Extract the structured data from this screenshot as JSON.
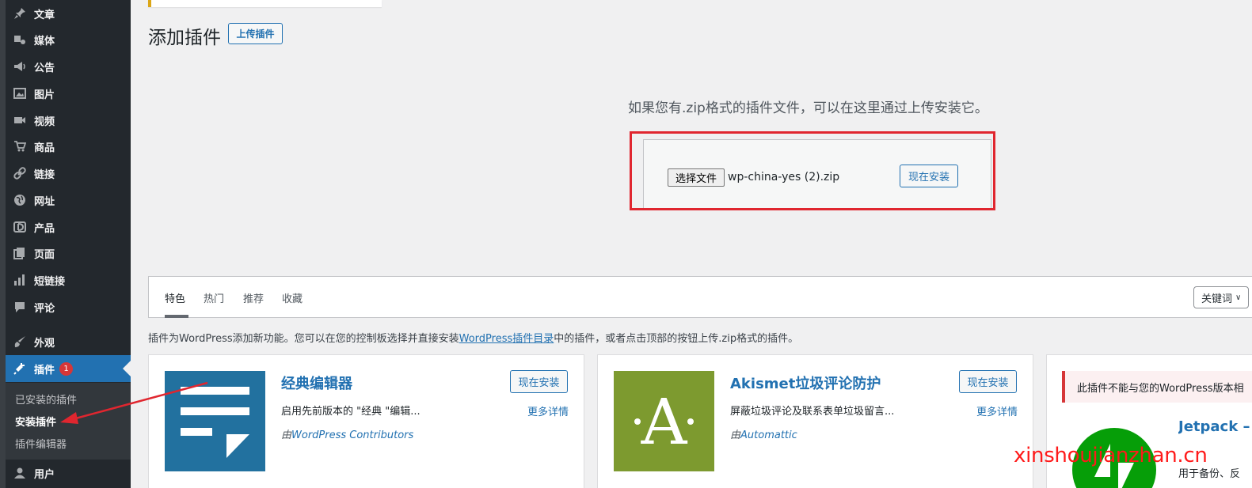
{
  "sidebar": {
    "items": [
      {
        "label": "文章",
        "icon": "pin-icon"
      },
      {
        "label": "媒体",
        "icon": "media-icon"
      },
      {
        "label": "公告",
        "icon": "megaphone-icon"
      },
      {
        "label": "图片",
        "icon": "image-icon"
      },
      {
        "label": "视频",
        "icon": "video-icon"
      },
      {
        "label": "商品",
        "icon": "cart-icon"
      },
      {
        "label": "链接",
        "icon": "link-icon"
      },
      {
        "label": "网址",
        "icon": "globe-icon"
      },
      {
        "label": "产品",
        "icon": "product-icon"
      },
      {
        "label": "页面",
        "icon": "pages-icon"
      },
      {
        "label": "短链接",
        "icon": "chart-icon"
      },
      {
        "label": "评论",
        "icon": "comment-icon"
      },
      {
        "label": "外观",
        "icon": "brush-icon"
      },
      {
        "label": "插件",
        "icon": "plug-icon",
        "badge": "1"
      },
      {
        "label": "用户",
        "icon": "user-icon"
      }
    ],
    "submenu": [
      "已安装的插件",
      "安装插件",
      "插件编辑器"
    ],
    "active_color": "#2271b1"
  },
  "page": {
    "title": "添加插件",
    "upload_button": "上传插件"
  },
  "upload": {
    "description": "如果您有.zip格式的插件文件，可以在这里通过上传安装它。",
    "choose_file": "选择文件",
    "file_name": "wp-china-yes (2).zip",
    "install_now": "现在安装"
  },
  "filter": {
    "tabs": [
      "特色",
      "热门",
      "推荐",
      "收藏"
    ],
    "search_type": "关键词"
  },
  "intro": {
    "before": "插件为WordPress添加新功能。您可以在您的控制板选择并直接安装",
    "link": "WordPress插件目录",
    "after": "中的插件，或者点击顶部的按钮上传.zip格式的插件。"
  },
  "cards": [
    {
      "title": "经典编辑器",
      "description": "启用先前版本的 \"经典 \"编辑...",
      "author_prefix": "由",
      "author": "WordPress Contributors",
      "install": "现在安装",
      "more": "更多详情"
    },
    {
      "title": "Akismet垃圾评论防护",
      "description": "屏蔽垃圾评论及联系表单垃圾留言...",
      "author_prefix": "由",
      "author": "Automattic",
      "install": "现在安装",
      "more": "更多详情"
    },
    {
      "notice": "此插件不能与您的WordPress版本相",
      "title": "Jetpack – 份、加速和",
      "description": "用于备份、反"
    }
  ],
  "watermark": "xinshoujianzhan.cn"
}
